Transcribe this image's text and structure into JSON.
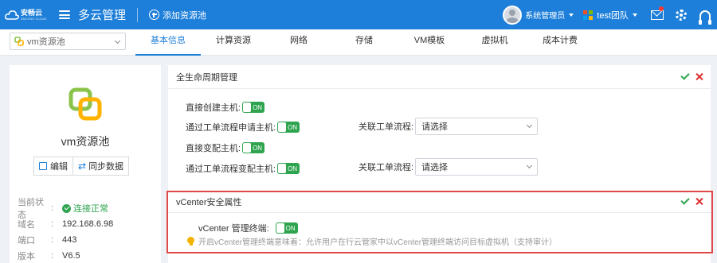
{
  "topbar": {
    "logo_text": "安畅云",
    "logo_sub": "ANCHNG CLOUD",
    "app_title": "多云管理",
    "add_pool_label": "添加资源池",
    "user_name": "系统管理员",
    "team_name": "test团队"
  },
  "subbar": {
    "pool_select_value": "vm资源池",
    "tabs": [
      {
        "label": "基本信息",
        "active": true
      },
      {
        "label": "计算资源"
      },
      {
        "label": "网络"
      },
      {
        "label": "存储"
      },
      {
        "label": "VM模板"
      },
      {
        "label": "虚拟机"
      },
      {
        "label": "成本计费"
      }
    ]
  },
  "left": {
    "pool_name": "vm资源池",
    "edit_label": "编辑",
    "sync_label": "同步数据",
    "props": [
      {
        "key": "当前状态",
        "colon": ":",
        "value": "连接正常"
      },
      {
        "key": "域名",
        "colon": ":",
        "value": "192.168.6.98"
      },
      {
        "key": "端口",
        "colon": ":",
        "value": "443"
      },
      {
        "key": "版本",
        "colon": ":",
        "value": "V6.5"
      }
    ]
  },
  "lifecycle": {
    "title": "全生命周期管理",
    "rows": [
      {
        "label": "直接创建主机:",
        "toggle": "ON"
      },
      {
        "label": "通过工单流程申请主机:",
        "toggle": "ON",
        "flow_label": "关联工单流程:",
        "flow_value": "请选择"
      },
      {
        "label": "直接变配主机:",
        "toggle": "ON"
      },
      {
        "label": "通过工单流程变配主机:",
        "toggle": "ON",
        "flow_label": "关联工单流程:",
        "flow_value": "请选择"
      }
    ]
  },
  "vcenter": {
    "title": "vCenter安全属性",
    "terminal_label": "vCenter 管理终端:",
    "terminal_toggle": "ON",
    "tip": "开启vCenter管理终端意味着：允许用户在行云管家中以vCenter管理终端访问目标虚拟机（支持审计）"
  },
  "colors": {
    "brand": "#1d7fd9",
    "success": "#2ea44f",
    "danger": "#e02f2f"
  }
}
